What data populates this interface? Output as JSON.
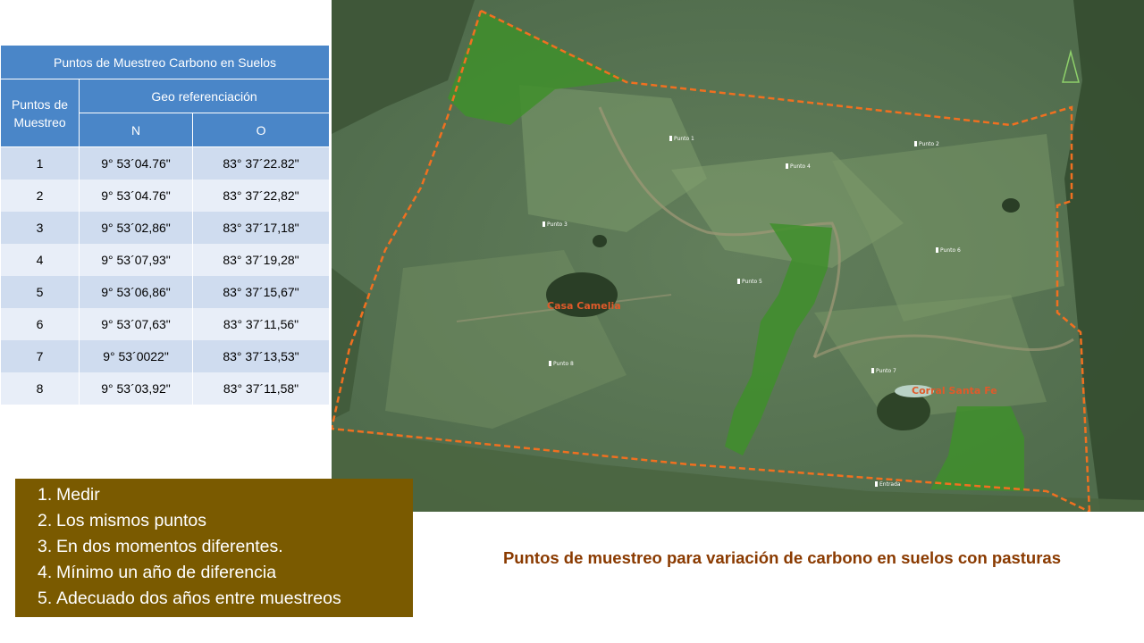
{
  "table": {
    "title": "Puntos de Muestreo Carbono en Suelos",
    "col_points": "Puntos de Muestreo",
    "col_geo": "Geo referenciación",
    "col_n": "N",
    "col_o": "O",
    "rows": [
      {
        "id": "1",
        "n": "9° 53´04.76\"",
        "o": "83° 37´22.82\""
      },
      {
        "id": "2",
        "n": "9° 53´04.76\"",
        "o": "83° 37´22,82\""
      },
      {
        "id": "3",
        "n": "9° 53´02,86\"",
        "o": "83° 37´17,18\""
      },
      {
        "id": "4",
        "n": "9° 53´07,93\"",
        "o": "83° 37´19,28\""
      },
      {
        "id": "5",
        "n": "9° 53´06,86\"",
        "o": "83° 37´15,67\""
      },
      {
        "id": "6",
        "n": "9° 53´07,63\"",
        "o": "83° 37´11,56\""
      },
      {
        "id": "7",
        "n": "9° 53´0022\"",
        "o": "83° 37´13,53\""
      },
      {
        "id": "8",
        "n": "9° 53´03,92\"",
        "o": "83° 37´11,58\""
      }
    ]
  },
  "map": {
    "point_labels": [
      "Punto 1",
      "Punto 2",
      "Punto 3",
      "Punto 4",
      "Punto 5",
      "Punto 6",
      "Punto 7",
      "Punto 8",
      "Entrada"
    ],
    "place_labels": [
      "Casa Camelia",
      "Corral Santa Fe"
    ],
    "boundary_color": "#f07020",
    "forest_color": "#3f8f2c"
  },
  "steps": {
    "items": [
      {
        "num": "1.",
        "text": "Medir"
      },
      {
        "num": "2.",
        "text": "Los mismos puntos"
      },
      {
        "num": "3.",
        "text": "En dos momentos diferentes."
      },
      {
        "num": "4.",
        "text": "Mínimo un año de diferencia"
      },
      {
        "num": "5.",
        "text": "Adecuado dos años entre muestreos"
      }
    ],
    "background": "#7a5a00"
  },
  "caption": "Puntos de muestreo para variación de carbono en suelos con pasturas"
}
